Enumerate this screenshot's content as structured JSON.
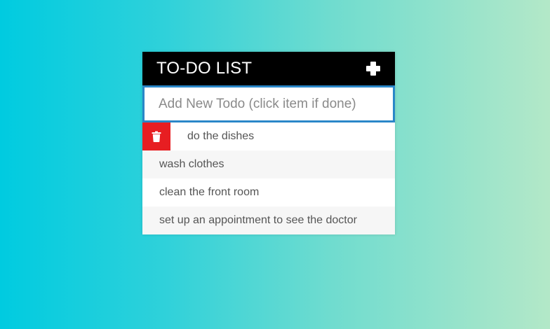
{
  "header": {
    "title": "TO-DO LIST",
    "add_icon": "plus-icon"
  },
  "new_todo": {
    "value": "",
    "placeholder": "Add New Todo (click item if done)"
  },
  "todos": [
    {
      "text": "do the dishes",
      "delete_visible": true,
      "delete_icon": "trash-icon"
    },
    {
      "text": "wash clothes"
    },
    {
      "text": "clean the front room"
    },
    {
      "text": "set up an appointment to see the doctor"
    }
  ],
  "colors": {
    "header_bg": "#000000",
    "delete_bg": "#e71e22",
    "input_border": "#2a87c8",
    "gradient_start": "#00cbe0",
    "gradient_end": "#b3e8c8"
  }
}
